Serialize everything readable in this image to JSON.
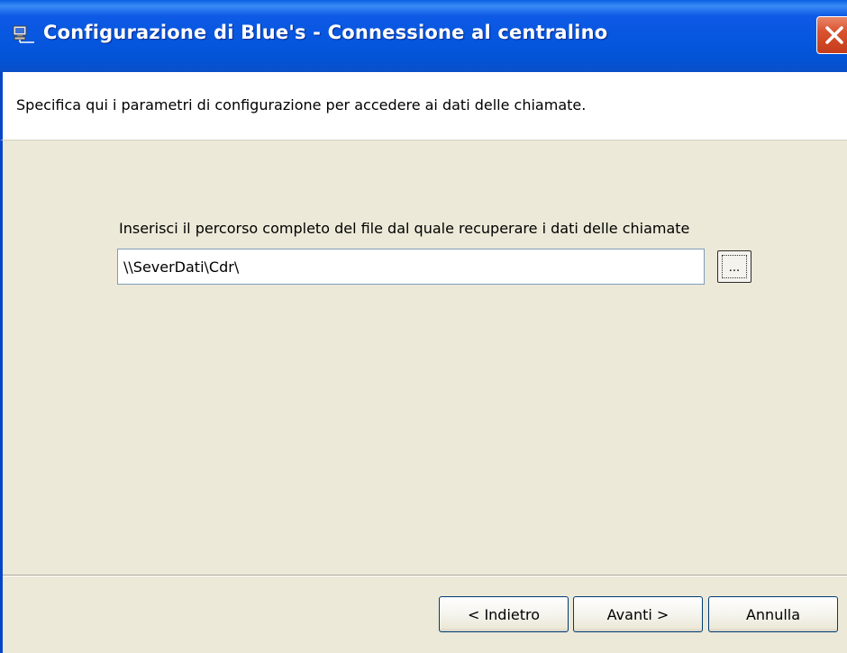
{
  "window": {
    "title": "Configurazione di Blue's - Connessione al centralino"
  },
  "header": {
    "description": "Specifica qui i parametri di configurazione per accedere ai dati delle chiamate."
  },
  "form": {
    "path_label": "Inserisci il percorso completo del file dal quale recuperare i dati delle chiamate",
    "path_value": "\\\\SeverDati\\Cdr\\",
    "browse_label": "..."
  },
  "buttons": {
    "back": "< Indietro",
    "next": "Avanti >",
    "cancel": "Annulla"
  },
  "icons": {
    "title_icon": "computer-network-icon",
    "close_icon": "close-icon"
  },
  "colors": {
    "titlebar": "#0556dd",
    "close": "#d8532f",
    "dialog_bg": "#ece9d8"
  }
}
